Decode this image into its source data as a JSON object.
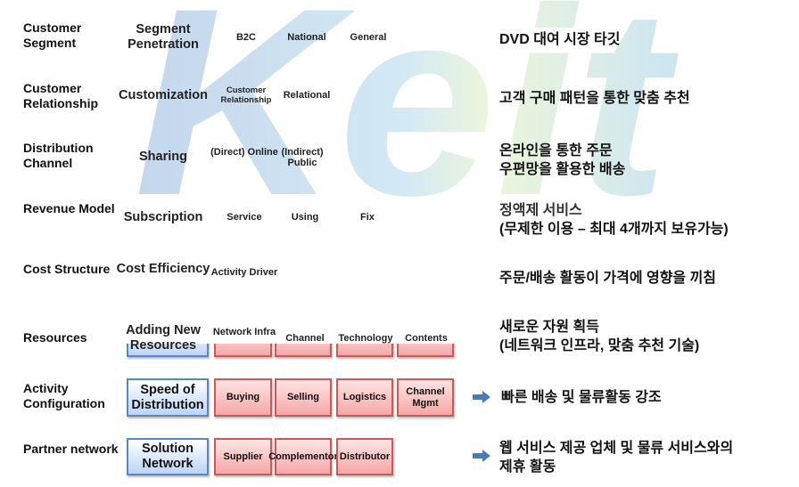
{
  "watermark": {
    "logo_text": "Keit",
    "pattern_text": "KEIT"
  },
  "rows": [
    {
      "label": "Customer Segment",
      "key": "Segment Penetration",
      "items": [
        "B2C",
        "National",
        "General"
      ],
      "description": [
        "DVD 대여 시장 타깃"
      ]
    },
    {
      "label": "Customer Relationship",
      "key": "Customization",
      "items": [
        "Customer Relationship",
        "Relational"
      ],
      "description": [
        "고객 구매 패턴을 통한 맞춤 추천"
      ]
    },
    {
      "label": "Distribution Channel",
      "key": "Sharing",
      "items": [
        "(Direct) Online",
        "(Indirect) Public"
      ],
      "description": [
        "온라인을 통한 주문",
        "우편망을 활용한 배송"
      ]
    },
    {
      "label": "Revenue Model",
      "key": "Subscription",
      "items": [
        "Service",
        "Using",
        "Fix"
      ],
      "description": [
        "정액제 서비스",
        "(무제한 이용 – 최대 4개까지 보유가능)"
      ]
    },
    {
      "label": "Cost Structure",
      "key": "Cost Efficiency",
      "items": [
        "Activity Driver"
      ],
      "description": [
        "주문/배송 활동이 가격에 영향을 끼침"
      ]
    },
    {
      "label": "Resources",
      "key": "Adding New Resources",
      "items": [
        "Network Infra",
        "Channel",
        "Technology",
        "Contents"
      ],
      "description": [
        "새로운 자원 획득",
        "(네트워크 인프라, 맞춤 추천 기술)"
      ]
    },
    {
      "label": "Activity Configuration",
      "key": "Speed of Distribution",
      "items": [
        "Buying",
        "Selling",
        "Logistics",
        "Channel Mgmt"
      ],
      "description": [
        "빠른 배송 및 물류활동 강조"
      ]
    },
    {
      "label": "Partner network",
      "key": "Solution Network",
      "items": [
        "Supplier",
        "Complementor",
        "Distributor"
      ],
      "description": [
        "웹 서비스 제공 업체 및 물류 서비스와의",
        "제휴 활동"
      ]
    }
  ],
  "colors": {
    "blue_box": "#bcd4f6",
    "blue_border": "#5b86c6",
    "pink_box": "#f5a7a7",
    "pink_border": "#c85a5a",
    "arrow": "#4a7ab8"
  }
}
